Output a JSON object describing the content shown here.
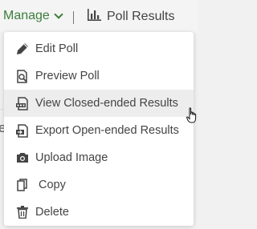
{
  "topbar": {
    "manage_label": "Manage",
    "poll_results_label": "Poll Results"
  },
  "background_fragment": "e",
  "menu": {
    "items": [
      {
        "label": "Edit Poll",
        "icon": "edit-icon"
      },
      {
        "label": "Preview Poll",
        "icon": "preview-icon"
      },
      {
        "label": "View Closed-ended Results",
        "icon": "pdf-results-icon",
        "hovered": true
      },
      {
        "label": "Export Open-ended Results",
        "icon": "export-icon"
      },
      {
        "label": "Upload Image",
        "icon": "camera-icon"
      },
      {
        "label": "Copy",
        "icon": "copy-icon"
      },
      {
        "label": "Delete",
        "icon": "trash-icon"
      }
    ]
  },
  "colors": {
    "accent": "#3c7d3c",
    "hover_bg": "#ededed",
    "text": "#444444"
  }
}
